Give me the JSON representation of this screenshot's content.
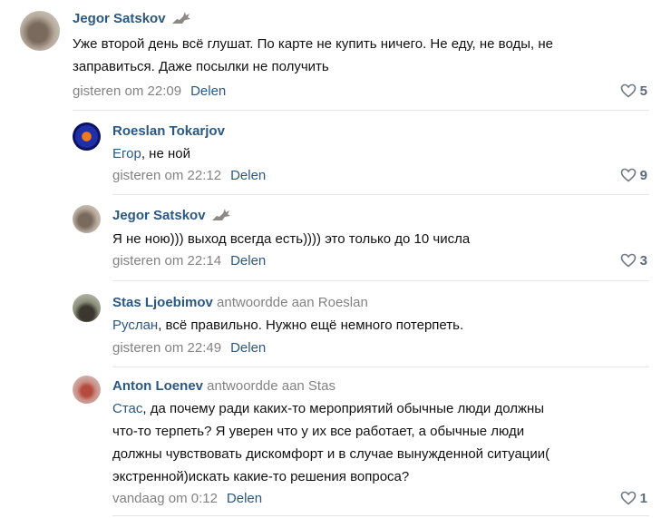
{
  "comments": [
    {
      "author": "Jegor Satskov",
      "text_lines": [
        "Уже второй день всё глушат. По карте не купить ничего. Не еду, не воды, не",
        "заправиться. Даже посылки не получить"
      ],
      "time": "gisteren om 22:09",
      "share": "Delen",
      "likes": "5"
    },
    {
      "author": "Roeslan Tokarjov",
      "addressee": "Егор",
      "text": ", не ной",
      "time": "gisteren om 22:12",
      "share": "Delen",
      "likes": "9"
    },
    {
      "author": "Jegor Satskov",
      "text": "Я не ною))) выход всегда есть)))) это только до 10 числа",
      "time": "gisteren om 22:14",
      "share": "Delen",
      "likes": "3"
    },
    {
      "author": "Stas Ljoebimov",
      "reply_to": "antwoordde aan Roeslan",
      "addressee": "Руслан",
      "text": ", всё правильно. Нужно ещё немного потерпеть.",
      "time": "gisteren om 22:49",
      "share": "Delen"
    },
    {
      "author": "Anton Loenev",
      "reply_to": "antwoordde aan Stas",
      "addressee": "Стас",
      "text_first": ", да почему ради каких-то мероприятий обычные люди должны",
      "text_lines": [
        "что-то терпеть? Я уверен что у их все работает, а обычные люди",
        "должны чувствовать дискомфорт и в случае вынужденной ситуации(",
        "экстренной)искать какие-то решения вопроса?"
      ],
      "time": "vandaag om 0:12",
      "share": "Delen",
      "likes": "1"
    }
  ],
  "colors": {
    "link": "#2a5885",
    "meta": "#828282",
    "divider": "#e4e6e9"
  },
  "icons": {
    "badge": "wolf-badge-icon",
    "like": "heart-outline-icon"
  }
}
